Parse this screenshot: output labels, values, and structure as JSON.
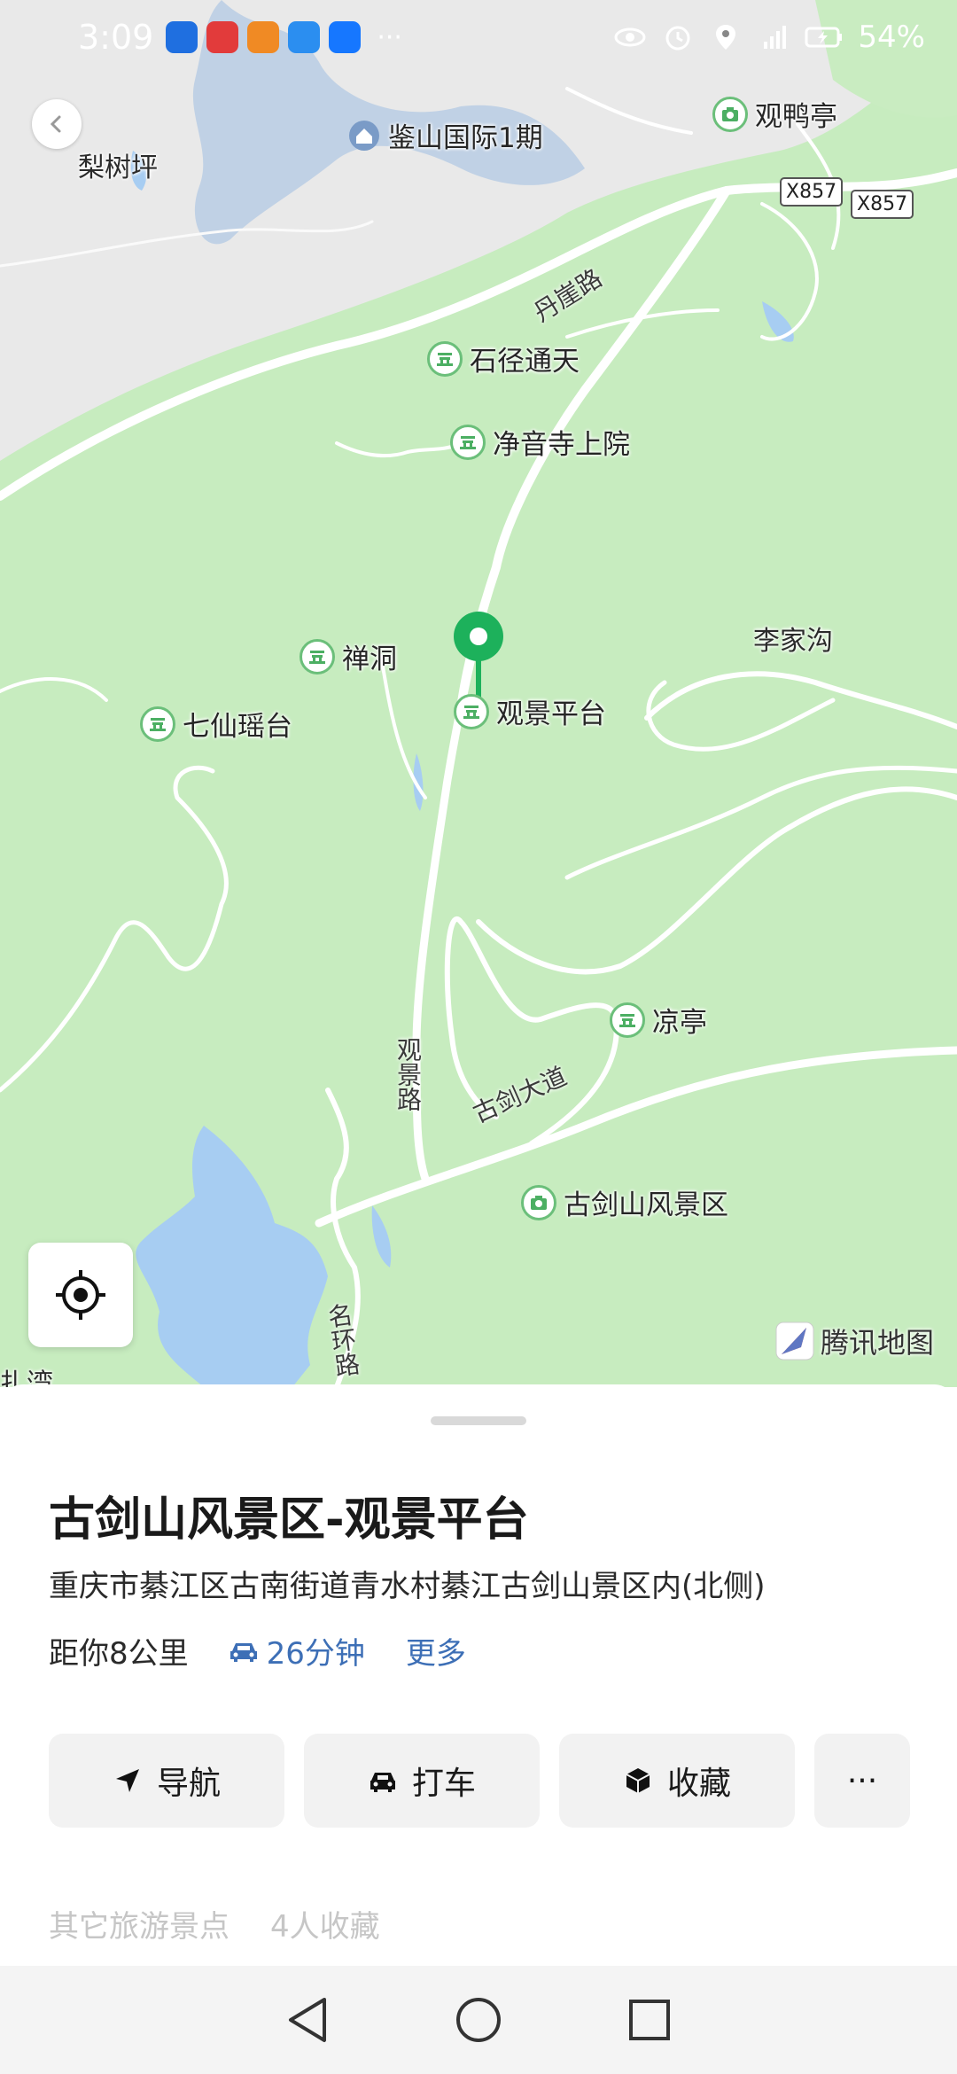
{
  "status_bar": {
    "time": "3:09",
    "app_icons": [
      "lightbulb-app-icon",
      "huawei-app-icon",
      "video-app-icon",
      "browser-app-icon",
      "alipay-app-icon"
    ],
    "more_indicator": "···",
    "battery_percent": "54%"
  },
  "map": {
    "place_labels": {
      "lishuping": "梨树坪",
      "jianshan": "鉴山国际1期",
      "lijiagou": "李家沟",
      "zhawan": "扎湾"
    },
    "pois": {
      "guanyating": "观鸭亭",
      "shijing": "石径通天",
      "jingyinsi": "净音寺上院",
      "chandong": "禅洞",
      "qixian": "七仙瑶台",
      "guanjing": "观景平台",
      "liangting": "凉亭",
      "gujianshan": "古剑山风景区"
    },
    "roads": {
      "danya": "丹崖路",
      "guanjing_road": "观景路",
      "gujian_avenue": "古剑大道",
      "minghuan": "名环路"
    },
    "shields": [
      "X857",
      "X857"
    ],
    "watermark": "腾讯地图",
    "colors": {
      "land": "#c7ecbf",
      "urban": "#e8e8e8",
      "water": "#a7cdf2",
      "pin": "#1db15b"
    }
  },
  "place": {
    "title": "古剑山风景区-观景平台",
    "address": "重庆市綦江区古南街道青水村綦江古剑山景区内(北侧)",
    "distance": "距你8公里",
    "drive_time": "26分钟",
    "more": "更多"
  },
  "actions": {
    "navigate": "导航",
    "taxi": "打车",
    "favorite": "收藏",
    "overflow": "···"
  },
  "extra": {
    "category": "其它旅游景点",
    "favorites": "4人收藏"
  }
}
